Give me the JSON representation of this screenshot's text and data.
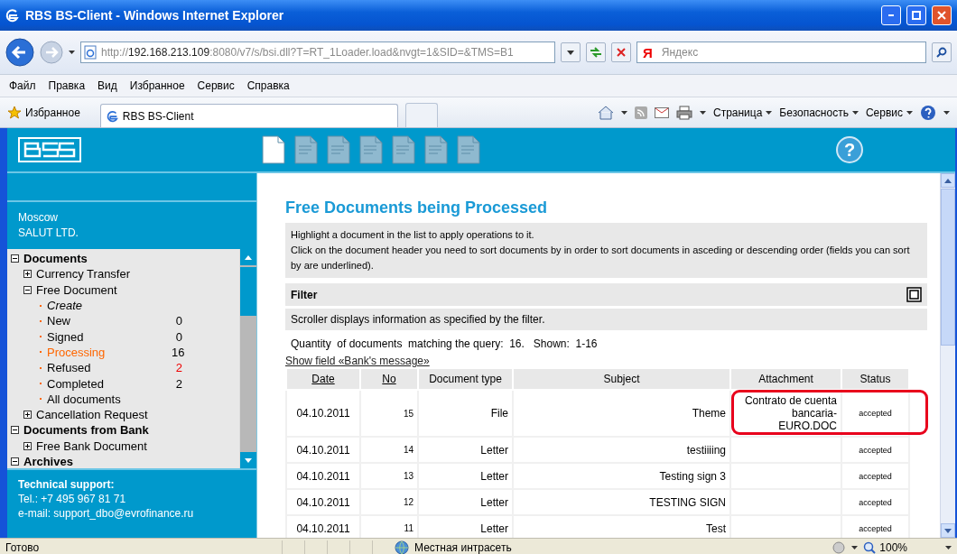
{
  "window": {
    "title": "RBS BS-Client - Windows Internet Explorer"
  },
  "address_bar": {
    "scheme": "http://",
    "host": "192.168.213.109",
    "path": ":8080/v7/s/bsi.dll?T=RT_1Loader.load&nvgt=1&SID=&TMS=B1"
  },
  "search": {
    "logo": "Я",
    "placeholder": "Яндекс"
  },
  "menu": [
    "Файл",
    "Правка",
    "Вид",
    "Избранное",
    "Сервис",
    "Справка"
  ],
  "favorites_bar": {
    "favorites": "Избранное",
    "tab": "RBS BS-Client",
    "commands": [
      "Страница",
      "Безопасность",
      "Сервис"
    ]
  },
  "sidebar": {
    "city": "Moscow",
    "company": "SALUT LTD.",
    "tree": [
      {
        "kind": "group",
        "label": "Documents",
        "expanded": true,
        "children": [
          {
            "kind": "group",
            "label": "Currency Transfer",
            "expanded": false
          },
          {
            "kind": "group",
            "label": "Free Document",
            "expanded": true,
            "children": [
              {
                "kind": "action",
                "label": "Create"
              },
              {
                "kind": "leaf",
                "label": "New",
                "count": "0",
                "selected": false,
                "alert": false
              },
              {
                "kind": "leaf",
                "label": "Signed",
                "count": "0",
                "selected": false,
                "alert": false
              },
              {
                "kind": "leaf",
                "label": "Processing",
                "count": "16",
                "selected": true,
                "alert": false
              },
              {
                "kind": "leaf",
                "label": "Refused",
                "count": "2",
                "selected": false,
                "alert": true
              },
              {
                "kind": "leaf",
                "label": "Completed",
                "count": "2",
                "selected": false,
                "alert": false
              },
              {
                "kind": "leaf",
                "label": "All documents",
                "selected": false
              }
            ]
          },
          {
            "kind": "group",
            "label": "Cancellation Request",
            "expanded": false
          }
        ]
      },
      {
        "kind": "group",
        "label": "Documents from Bank",
        "expanded": true,
        "children": [
          {
            "kind": "group",
            "label": "Free Bank Document",
            "expanded": false
          }
        ]
      },
      {
        "kind": "group",
        "label": "Archives",
        "expanded": true
      }
    ],
    "support": {
      "title": "Technical support:",
      "phone": "Tel.: +7 495 967 81 71",
      "email": "e-mail: support_dbo@evrofinance.ru"
    }
  },
  "app_header": {
    "help": "?"
  },
  "content": {
    "title": "Free Documents being Processed",
    "info": [
      "Highlight a document in the list to apply operations to it.",
      "Click on the document header you need to sort documents by in order to sort documents in asceding or descending order (fields you can sort by are underlined)."
    ],
    "filter": {
      "title": "Filter",
      "note": "Scroller displays information as specified by the filter."
    },
    "quantity": "Quantity  of documents  matching the query:  16.   Shown:  1-16",
    "show_field_link": "Show field «Bank's message»",
    "table": {
      "columns": [
        {
          "label": "Date",
          "sortable": true
        },
        {
          "label": "No",
          "sortable": true
        },
        {
          "label": "Document type",
          "sortable": false
        },
        {
          "label": "Subject",
          "sortable": false
        },
        {
          "label": "Attachment",
          "sortable": false
        },
        {
          "label": "Status",
          "sortable": false
        }
      ],
      "rows": [
        [
          "04.10.2011",
          "15",
          "File",
          "Theme",
          "Contrato de cuenta bancaria-EURO.DOC",
          "accepted"
        ],
        [
          "04.10.2011",
          "14",
          "Letter",
          "testiiiing",
          "",
          "accepted"
        ],
        [
          "04.10.2011",
          "13",
          "Letter",
          "Testing sign 3",
          "",
          "accepted"
        ],
        [
          "04.10.2011",
          "12",
          "Letter",
          "TESTING SIGN",
          "",
          "accepted"
        ],
        [
          "04.10.2011",
          "11",
          "Letter",
          "Test",
          "",
          "accepted"
        ]
      ]
    }
  },
  "status_bar": {
    "status": "Готово",
    "zone": "Местная интрасеть",
    "zoom": "100%"
  }
}
